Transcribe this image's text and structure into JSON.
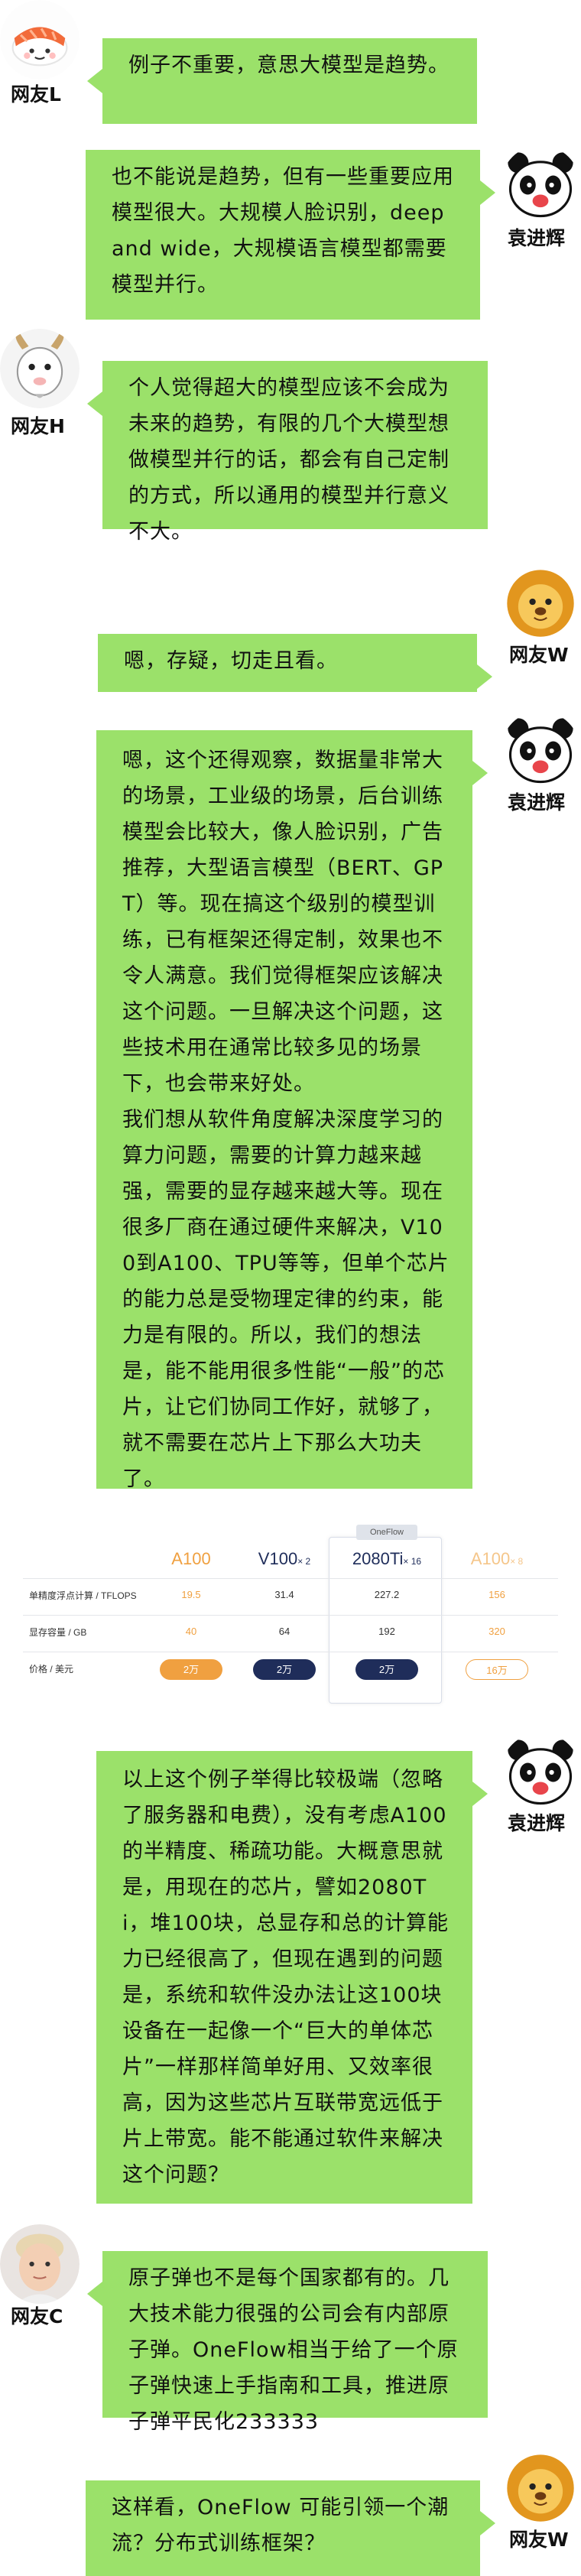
{
  "messages": [
    {
      "speaker": "网友L",
      "text": "例子不重要，意思大模型是趋势。"
    },
    {
      "speaker": "袁进辉",
      "text": "也不能说是趋势，但有一些重要应用模型很大。大规模人脸识别，deep and wide，大规模语言模型都需要模型并行。"
    },
    {
      "speaker": "网友H",
      "text": "个人觉得超大的模型应该不会成为未来的趋势，有限的几个大模型想做模型并行的话，都会有自己定制的方式，所以通用的模型并行意义不大。"
    },
    {
      "speaker": "网友W",
      "text": "嗯，存疑，切走且看。"
    },
    {
      "speaker": "袁进辉",
      "text": "嗯，这个还得观察，数据量非常大的场景，工业级的场景，后台训练模型会比较大，像人脸识别，广告推荐，大型语言模型（BERT、GPT）等。现在搞这个级别的模型训练，已有框架还得定制，效果也不令人满意。我们觉得框架应该解决这个问题。一旦解决这个问题，这些技术用在通常比较多见的场景下，也会带来好处。\n我们想从软件角度解决深度学习的算力问题，需要的计算力越来越强，需要的显存越来越大等。现在很多厂商在通过硬件来解决，V100到A100、TPU等等，但单个芯片的能力总是受物理定律的约束，能力是有限的。所以，我们的想法是，能不能用很多性能“一般”的芯片，让它们协同工作好，就够了，就不需要在芯片上下那么大功夫了。"
    },
    {
      "speaker": "袁进辉",
      "text": "以上这个例子举得比较极端（忽略了服务器和电费），没有考虑A100 的半精度、稀疏功能。大概意思就是，用现在的芯片，譬如2080Ti，堆100块，总显存和总的计算能力已经很高了，但现在遇到的问题是，系统和软件没办法让这100块设备在一起像一个“巨大的单体芯片”一样那样简单好用、又效率很高，因为这些芯片互联带宽远低于片上带宽。能不能通过软件来解决这个问题？"
    },
    {
      "speaker": "网友C",
      "text": "原子弹也不是每个国家都有的。几大技术能力很强的公司会有内部原子弹。OneFlow相当于给了一个原子弹快速上手指南和工具，推进原子弹平民化233333"
    },
    {
      "speaker": "网友W",
      "text": "这样看，OneFlow 可能引领一个潮流？分布式训练框架？"
    }
  ],
  "comparison": {
    "badge": "OneFlow",
    "row_labels": [
      "单精度浮点计算 / TFLOPS",
      "显存容量 / GB",
      "价格 / 美元"
    ],
    "columns": [
      {
        "name": "A100",
        "mult": "",
        "tflops": "19.5",
        "memory": "40",
        "price": "2万",
        "color": "#f0a040"
      },
      {
        "name": "V100",
        "mult": "× 2",
        "tflops": "31.4",
        "memory": "64",
        "price": "2万",
        "color": "#1f2d5a"
      },
      {
        "name": "2080Ti",
        "mult": "× 16",
        "tflops": "227.2",
        "memory": "192",
        "price": "2万",
        "color": "#1f2d5a"
      },
      {
        "name": "A100",
        "mult": "× 8",
        "tflops": "156",
        "memory": "320",
        "price": "16万",
        "color": "#f0a040"
      }
    ]
  },
  "colors": {
    "bubble": "#9be16a",
    "accent_orange": "#f0a040",
    "accent_navy": "#1f2d5a"
  }
}
